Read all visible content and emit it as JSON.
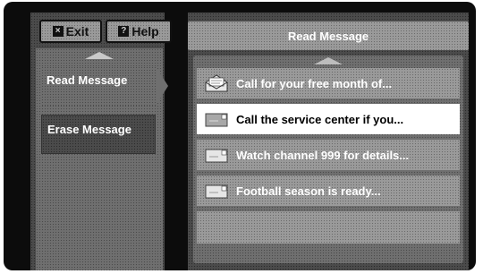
{
  "top_buttons": {
    "exit_glyph": "×",
    "exit_label": "Exit",
    "help_glyph": "?",
    "help_label": "Help"
  },
  "menu": {
    "items": [
      {
        "label": "Read Message",
        "selected": true
      },
      {
        "label": "Erase Message",
        "selected": false
      }
    ]
  },
  "panel": {
    "title": "Read Message",
    "messages": [
      {
        "text": "Call for your free month of...",
        "icon": "open-envelope-icon",
        "status": "read",
        "highlighted": false
      },
      {
        "text": "Call the service center if you...",
        "icon": "closed-envelope-icon",
        "status": "unread",
        "highlighted": true
      },
      {
        "text": "Watch channel 999 for details...",
        "icon": "closed-envelope-icon",
        "status": "unread",
        "highlighted": false
      },
      {
        "text": "Football season is ready...",
        "icon": "closed-envelope-icon",
        "status": "unread",
        "highlighted": false
      }
    ]
  },
  "colors": {
    "frame": "#0c0c0c",
    "highlight_row": "#ffffff",
    "text": "#ffffff"
  }
}
